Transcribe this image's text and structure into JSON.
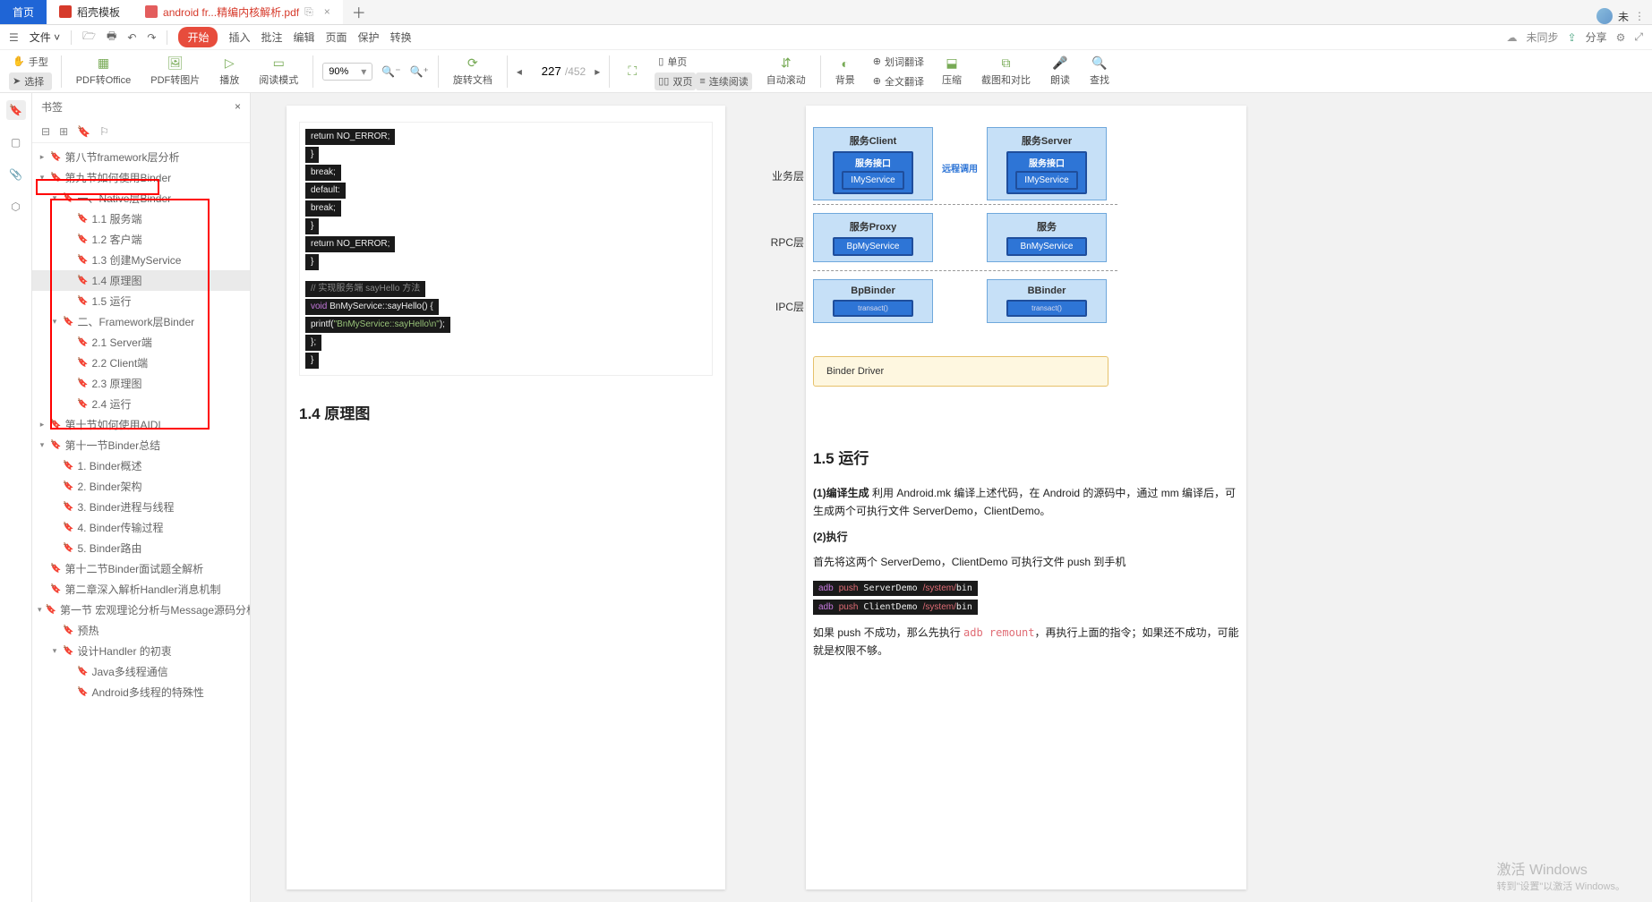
{
  "tabs": {
    "home": "首页",
    "dokel": "稻壳模板",
    "active": "android fr...精编内核解析.pdf",
    "user": "未"
  },
  "menubar": {
    "file": "文件",
    "start": "开始",
    "menu": [
      "插入",
      "批注",
      "编辑",
      "页面",
      "保护",
      "转换"
    ],
    "unsync": "未同步",
    "share": "分享"
  },
  "toolbar": {
    "hand": "手型",
    "select": "选择",
    "pdf2office": "PDF转Office",
    "pdf2img": "PDF转图片",
    "play": "播放",
    "readmode": "阅读模式",
    "zoom": "90%",
    "rotate": "旋转文档",
    "page_cur": "227",
    "page_total": "/452",
    "single": "单页",
    "double": "双页",
    "cont": "连续阅读",
    "autoscroll": "自动滚动",
    "navicon": "⛶",
    "bg": "背景",
    "wordTrans": "划词翻译",
    "fullTrans": "全文翻译",
    "compress": "压缩",
    "screenshot": "截图和对比",
    "read": "朗读",
    "find": "查找"
  },
  "sidebar": {
    "title": "书签",
    "items": [
      {
        "lvl": 0,
        "arrow": "▸",
        "txt": "第八节framework层分析"
      },
      {
        "lvl": 0,
        "arrow": "▾",
        "txt": "第九节如何使用Binder",
        "sel": false
      },
      {
        "lvl": 1,
        "arrow": "▾",
        "txt": "一、Native层Binder"
      },
      {
        "lvl": 2,
        "arrow": "",
        "txt": "1.1 服务端"
      },
      {
        "lvl": 2,
        "arrow": "",
        "txt": "1.2 客户端"
      },
      {
        "lvl": 2,
        "arrow": "",
        "txt": "1.3 创建MyService"
      },
      {
        "lvl": 2,
        "arrow": "",
        "txt": "1.4 原理图",
        "sel": true
      },
      {
        "lvl": 2,
        "arrow": "",
        "txt": "1.5 运行"
      },
      {
        "lvl": 1,
        "arrow": "▾",
        "txt": "二、Framework层Binder"
      },
      {
        "lvl": 2,
        "arrow": "",
        "txt": "2.1 Server端"
      },
      {
        "lvl": 2,
        "arrow": "",
        "txt": "2.2 Client端"
      },
      {
        "lvl": 2,
        "arrow": "",
        "txt": "2.3 原理图"
      },
      {
        "lvl": 2,
        "arrow": "",
        "txt": "2.4 运行"
      },
      {
        "lvl": 0,
        "arrow": "▸",
        "txt": "第十节如何使用AIDL"
      },
      {
        "lvl": 0,
        "arrow": "▾",
        "txt": "第十一节Binder总结"
      },
      {
        "lvl": 1,
        "arrow": "",
        "txt": "1. Binder概述"
      },
      {
        "lvl": 1,
        "arrow": "",
        "txt": "2. Binder架构"
      },
      {
        "lvl": 1,
        "arrow": "",
        "txt": "3. Binder进程与线程"
      },
      {
        "lvl": 1,
        "arrow": "",
        "txt": "4. Binder传输过程"
      },
      {
        "lvl": 1,
        "arrow": "",
        "txt": "5. Binder路由"
      },
      {
        "lvl": 0,
        "arrow": "",
        "txt": "第十二节Binder面试题全解析"
      },
      {
        "lvl": 0,
        "arrow": "",
        "txt": "第二章深入解析Handler消息机制"
      },
      {
        "lvl": 0,
        "arrow": "▾",
        "txt": "第一节 宏观理论分析与Message源码分析"
      },
      {
        "lvl": 1,
        "arrow": "",
        "txt": "预热"
      },
      {
        "lvl": 1,
        "arrow": "▾",
        "txt": "设计Handler 的初衷"
      },
      {
        "lvl": 2,
        "arrow": "",
        "txt": "Java多线程通信"
      },
      {
        "lvl": 2,
        "arrow": "",
        "txt": "Android多线程的特殊性"
      }
    ]
  },
  "page1": {
    "code": [
      {
        "txt": "        return NO_ERROR;"
      },
      {
        "txt": "    }"
      },
      {
        "txt": "        break;"
      },
      {
        "txt": "    default:"
      },
      {
        "txt": "        break;"
      },
      {
        "txt": "    }"
      },
      {
        "txt": "    return NO_ERROR;"
      },
      {
        "txt": "}"
      },
      {
        "txt": ""
      },
      {
        "txt": "   // 实现服务端 sayHello 方法",
        "cls": "cm"
      },
      {
        "txt": "   void BnMyService::sayHello() {",
        "cls": "kw"
      },
      {
        "txt": "     printf(\"BnMyService::sayHello\\n\");",
        "cls": "st"
      },
      {
        "txt": "   };"
      },
      {
        "txt": "}"
      }
    ],
    "heading": "1.4  原理图"
  },
  "page2": {
    "diagram": {
      "layers": [
        "业务层",
        "RPC层",
        "IPC层"
      ],
      "remote_call": "远程调用",
      "client": {
        "title": "服务Client",
        "sub1": "服务接口",
        "in": "IMyService"
      },
      "server": {
        "title": "服务Server",
        "sub1": "服务接口",
        "in": "IMyService"
      },
      "proxy": {
        "title": "服务Proxy",
        "in": "BpMyService"
      },
      "svc": {
        "title": "服务",
        "in": "BnMyService"
      },
      "bpbinder": {
        "title": "BpBinder",
        "in": "transact()"
      },
      "bbinder": {
        "title": "BBinder",
        "in": "transact()"
      },
      "driver": "Binder Driver"
    },
    "heading": "1.5  运行",
    "p1_label": "(1)编译生成",
    "p1": " 利用 Android.mk 编译上述代码，在 Android 的源码中，通过 mm 编译后，可生成两个可执行文件 ServerDemo，ClientDemo。",
    "p2_label": "(2)执行",
    "p3": "首先将这两个 ServerDemo，ClientDemo 可执行文件 push 到手机",
    "cmd1": "adb push ServerDemo /system/bin",
    "cmd2": "adb push ClientDemo /system/bin",
    "p4_a": "如果 push 不成功，那么先执行 ",
    "p4_code": "adb remount",
    "p4_b": "，再执行上面的指令；如果还不成功，可能就是权限不够。"
  },
  "watermark": {
    "t1": "激活 Windows",
    "t2": "转到\"设置\"以激活 Windows。"
  }
}
